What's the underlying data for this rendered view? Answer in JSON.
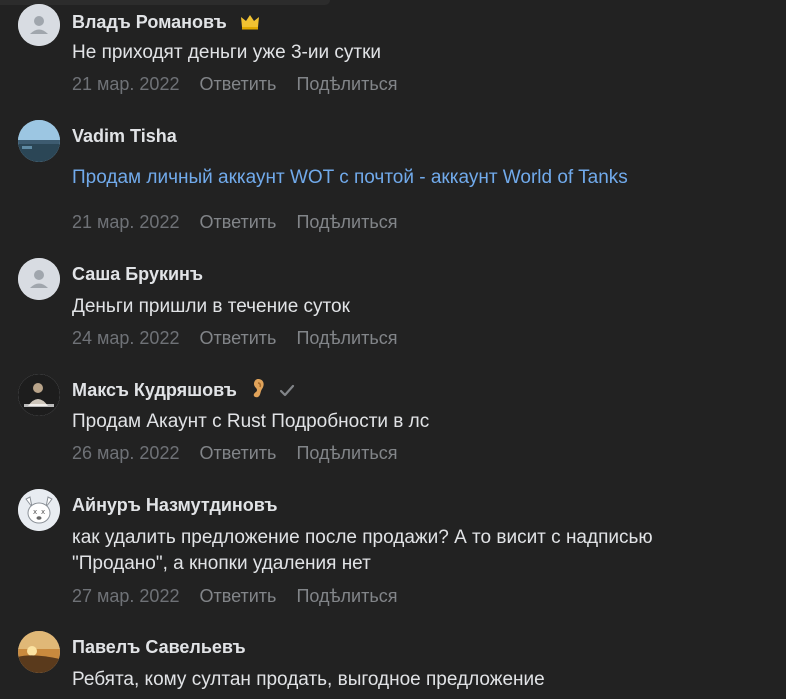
{
  "comments": [
    {
      "author": "Владъ Романовъ",
      "badge_icon": "crown-icon",
      "text": "Не приходят деньги уже 3-ии сутки",
      "date": "21 мар. 2022",
      "reply": "Ответить",
      "share": "Подѣлиться",
      "avatar": "default-avatar"
    },
    {
      "author": "Vadim Tisha",
      "text": "Продам личный аккаунт WOT с почтой - аккаунт World of Tanks",
      "text_is_link": true,
      "date": "21 мар. 2022",
      "reply": "Ответить",
      "share": "Подѣлиться",
      "avatar": "landscape-photo"
    },
    {
      "author": "Саша Брукинъ",
      "text": "Деньги пришли в течение суток",
      "date": "24 мар. 2022",
      "reply": "Ответить",
      "share": "Подѣлиться",
      "avatar": "default-avatar"
    },
    {
      "author": "Максъ Кудряшовъ",
      "badge_icon": "ear-icon",
      "verified_icon": "checkmark-icon",
      "text": "Продам Акаунт с Rust Подробности в лс",
      "date": "26 мар. 2022",
      "reply": "Ответить",
      "share": "Подѣлиться",
      "avatar": "person-photo"
    },
    {
      "author": "Айнуръ Назмутдиновъ",
      "text_lines": [
        "как удалить предложение после продажи? А то висит с надписью",
        "\"Продано\", а кнопки удаления нет"
      ],
      "date": "27 мар. 2022",
      "reply": "Ответить",
      "share": "Подѣлиться",
      "avatar": "dog-avatar"
    },
    {
      "author": "Павелъ Савельевъ",
      "text": "Ребята, кому султан продать, выгодное предложение",
      "avatar": "sunset-photo"
    }
  ],
  "colors": {
    "background": "#222222",
    "text": "#e1e3e6",
    "link": "#71aaeb",
    "meta": "#6f7277",
    "default_avatar": "#d8dce2"
  }
}
